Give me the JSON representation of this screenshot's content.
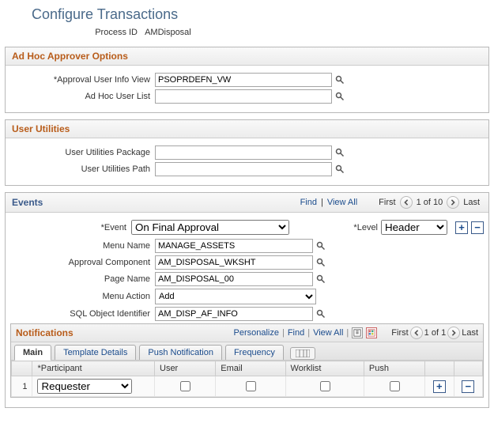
{
  "page_title": "Configure Transactions",
  "process_id": {
    "label": "Process ID",
    "value": "AMDisposal"
  },
  "adhoc": {
    "title": "Ad Hoc Approver Options",
    "approval_view": {
      "label": "*Approval User Info View",
      "value": "PSOPRDEFN_VW"
    },
    "user_list": {
      "label": "Ad Hoc User List",
      "value": ""
    }
  },
  "user_util": {
    "title": "User Utilities",
    "package": {
      "label": "User Utilities Package",
      "value": ""
    },
    "path": {
      "label": "User Utilities Path",
      "value": ""
    }
  },
  "events": {
    "title": "Events",
    "links": {
      "find": "Find",
      "view_all": "View All"
    },
    "pager": {
      "first": "First",
      "pos": "1 of 10",
      "last": "Last"
    },
    "event": {
      "label": "*Event",
      "value": "On Final Approval"
    },
    "level": {
      "label": "*Level",
      "value": "Header"
    },
    "menu_name": {
      "label": "Menu Name",
      "value": "MANAGE_ASSETS"
    },
    "approval_component": {
      "label": "Approval Component",
      "value": "AM_DISPOSAL_WKSHT"
    },
    "page_name": {
      "label": "Page Name",
      "value": "AM_DISPOSAL_00"
    },
    "menu_action": {
      "label": "Menu Action",
      "value": "Add"
    },
    "sql_obj": {
      "label": "SQL Object Identifier",
      "value": "AM_DISP_AF_INFO"
    }
  },
  "notifications": {
    "title": "Notifications",
    "links": {
      "personalize": "Personalize",
      "find": "Find",
      "view_all": "View All"
    },
    "pager": {
      "first": "First",
      "pos": "1 of 1",
      "last": "Last"
    },
    "tabs": [
      "Main",
      "Template Details",
      "Push Notification",
      "Frequency"
    ],
    "columns": {
      "num": " ",
      "participant": "*Participant",
      "user": "User",
      "email": "Email",
      "worklist": "Worklist",
      "push": "Push"
    },
    "rows": [
      {
        "num": "1",
        "participant": "Requester",
        "user": false,
        "email": false,
        "worklist": false,
        "push": false
      }
    ]
  }
}
